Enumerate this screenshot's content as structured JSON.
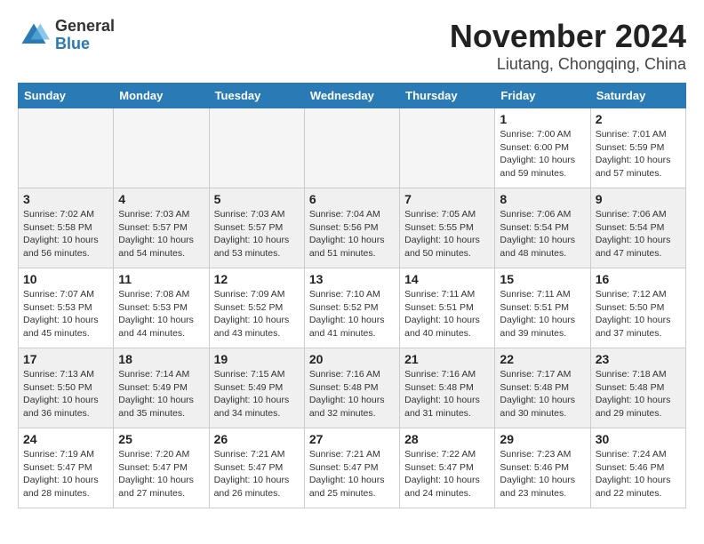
{
  "header": {
    "logo_general": "General",
    "logo_blue": "Blue",
    "month_title": "November 2024",
    "location": "Liutang, Chongqing, China"
  },
  "weekdays": [
    "Sunday",
    "Monday",
    "Tuesday",
    "Wednesday",
    "Thursday",
    "Friday",
    "Saturday"
  ],
  "weeks": [
    [
      {
        "day": "",
        "empty": true
      },
      {
        "day": "",
        "empty": true
      },
      {
        "day": "",
        "empty": true
      },
      {
        "day": "",
        "empty": true
      },
      {
        "day": "",
        "empty": true
      },
      {
        "day": "1",
        "info": "Sunrise: 7:00 AM\nSunset: 6:00 PM\nDaylight: 10 hours\nand 59 minutes."
      },
      {
        "day": "2",
        "info": "Sunrise: 7:01 AM\nSunset: 5:59 PM\nDaylight: 10 hours\nand 57 minutes."
      }
    ],
    [
      {
        "day": "3",
        "info": "Sunrise: 7:02 AM\nSunset: 5:58 PM\nDaylight: 10 hours\nand 56 minutes.",
        "shaded": true
      },
      {
        "day": "4",
        "info": "Sunrise: 7:03 AM\nSunset: 5:57 PM\nDaylight: 10 hours\nand 54 minutes.",
        "shaded": true
      },
      {
        "day": "5",
        "info": "Sunrise: 7:03 AM\nSunset: 5:57 PM\nDaylight: 10 hours\nand 53 minutes.",
        "shaded": true
      },
      {
        "day": "6",
        "info": "Sunrise: 7:04 AM\nSunset: 5:56 PM\nDaylight: 10 hours\nand 51 minutes.",
        "shaded": true
      },
      {
        "day": "7",
        "info": "Sunrise: 7:05 AM\nSunset: 5:55 PM\nDaylight: 10 hours\nand 50 minutes.",
        "shaded": true
      },
      {
        "day": "8",
        "info": "Sunrise: 7:06 AM\nSunset: 5:54 PM\nDaylight: 10 hours\nand 48 minutes.",
        "shaded": true
      },
      {
        "day": "9",
        "info": "Sunrise: 7:06 AM\nSunset: 5:54 PM\nDaylight: 10 hours\nand 47 minutes.",
        "shaded": true
      }
    ],
    [
      {
        "day": "10",
        "info": "Sunrise: 7:07 AM\nSunset: 5:53 PM\nDaylight: 10 hours\nand 45 minutes."
      },
      {
        "day": "11",
        "info": "Sunrise: 7:08 AM\nSunset: 5:53 PM\nDaylight: 10 hours\nand 44 minutes."
      },
      {
        "day": "12",
        "info": "Sunrise: 7:09 AM\nSunset: 5:52 PM\nDaylight: 10 hours\nand 43 minutes."
      },
      {
        "day": "13",
        "info": "Sunrise: 7:10 AM\nSunset: 5:52 PM\nDaylight: 10 hours\nand 41 minutes."
      },
      {
        "day": "14",
        "info": "Sunrise: 7:11 AM\nSunset: 5:51 PM\nDaylight: 10 hours\nand 40 minutes."
      },
      {
        "day": "15",
        "info": "Sunrise: 7:11 AM\nSunset: 5:51 PM\nDaylight: 10 hours\nand 39 minutes."
      },
      {
        "day": "16",
        "info": "Sunrise: 7:12 AM\nSunset: 5:50 PM\nDaylight: 10 hours\nand 37 minutes."
      }
    ],
    [
      {
        "day": "17",
        "info": "Sunrise: 7:13 AM\nSunset: 5:50 PM\nDaylight: 10 hours\nand 36 minutes.",
        "shaded": true
      },
      {
        "day": "18",
        "info": "Sunrise: 7:14 AM\nSunset: 5:49 PM\nDaylight: 10 hours\nand 35 minutes.",
        "shaded": true
      },
      {
        "day": "19",
        "info": "Sunrise: 7:15 AM\nSunset: 5:49 PM\nDaylight: 10 hours\nand 34 minutes.",
        "shaded": true
      },
      {
        "day": "20",
        "info": "Sunrise: 7:16 AM\nSunset: 5:48 PM\nDaylight: 10 hours\nand 32 minutes.",
        "shaded": true
      },
      {
        "day": "21",
        "info": "Sunrise: 7:16 AM\nSunset: 5:48 PM\nDaylight: 10 hours\nand 31 minutes.",
        "shaded": true
      },
      {
        "day": "22",
        "info": "Sunrise: 7:17 AM\nSunset: 5:48 PM\nDaylight: 10 hours\nand 30 minutes.",
        "shaded": true
      },
      {
        "day": "23",
        "info": "Sunrise: 7:18 AM\nSunset: 5:48 PM\nDaylight: 10 hours\nand 29 minutes.",
        "shaded": true
      }
    ],
    [
      {
        "day": "24",
        "info": "Sunrise: 7:19 AM\nSunset: 5:47 PM\nDaylight: 10 hours\nand 28 minutes."
      },
      {
        "day": "25",
        "info": "Sunrise: 7:20 AM\nSunset: 5:47 PM\nDaylight: 10 hours\nand 27 minutes."
      },
      {
        "day": "26",
        "info": "Sunrise: 7:21 AM\nSunset: 5:47 PM\nDaylight: 10 hours\nand 26 minutes."
      },
      {
        "day": "27",
        "info": "Sunrise: 7:21 AM\nSunset: 5:47 PM\nDaylight: 10 hours\nand 25 minutes."
      },
      {
        "day": "28",
        "info": "Sunrise: 7:22 AM\nSunset: 5:47 PM\nDaylight: 10 hours\nand 24 minutes."
      },
      {
        "day": "29",
        "info": "Sunrise: 7:23 AM\nSunset: 5:46 PM\nDaylight: 10 hours\nand 23 minutes."
      },
      {
        "day": "30",
        "info": "Sunrise: 7:24 AM\nSunset: 5:46 PM\nDaylight: 10 hours\nand 22 minutes."
      }
    ]
  ]
}
